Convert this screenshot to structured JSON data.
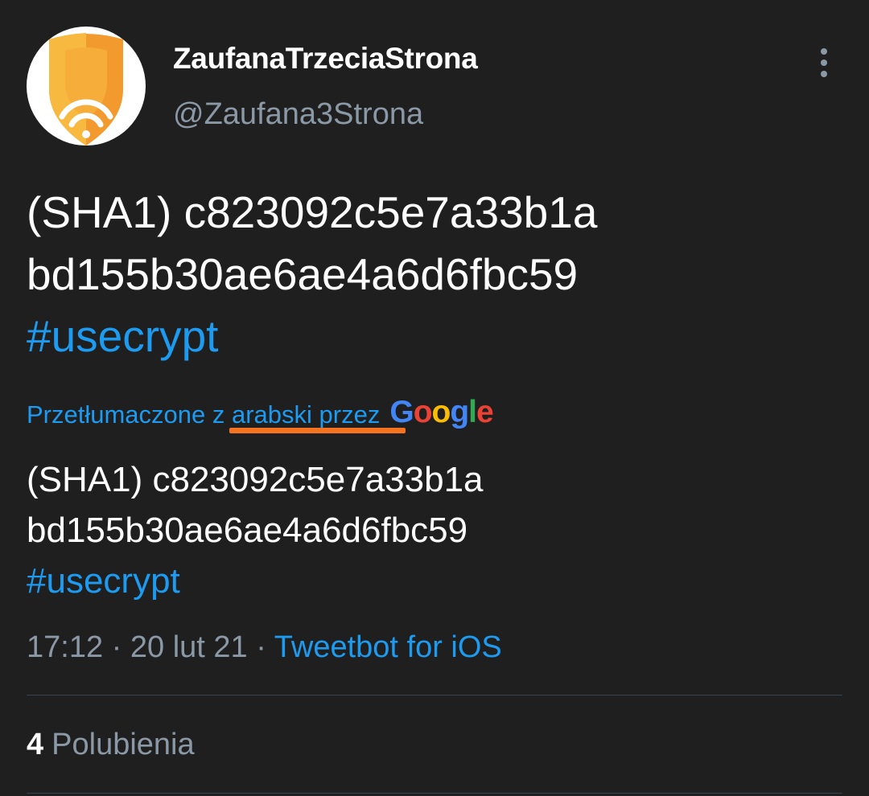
{
  "author": {
    "display_name": "ZaufanaTrzeciaStrona",
    "handle": "@Zaufana3Strona",
    "avatar_icon": "orange-shield-wifi-logo"
  },
  "menu": {
    "icon": "more-vertical-icon"
  },
  "tweet": {
    "lines": [
      "(SHA1) c823092c5e7a33b1a",
      "bd155b30ae6ae4a6d6fbc59"
    ],
    "hashtag": "#usecrypt"
  },
  "translation": {
    "label": "Przetłumaczone z arabski przez",
    "provider": "Google",
    "lines": [
      "(SHA1) c823092c5e7a33b1a",
      "bd155b30ae6ae4a6d6fbc59"
    ],
    "hashtag": "#usecrypt"
  },
  "meta": {
    "time": "17:12",
    "separator": "·",
    "date": "20 lut 21",
    "source": "Tweetbot for iOS"
  },
  "stats": {
    "likes_count": "4",
    "likes_label": "Polubienia"
  },
  "colors": {
    "background": "#1f1f1f",
    "link": "#1d9bf0",
    "secondary_text": "#8b98a5",
    "annotation": "#f37320",
    "avatar_orange": "#f5a330"
  }
}
